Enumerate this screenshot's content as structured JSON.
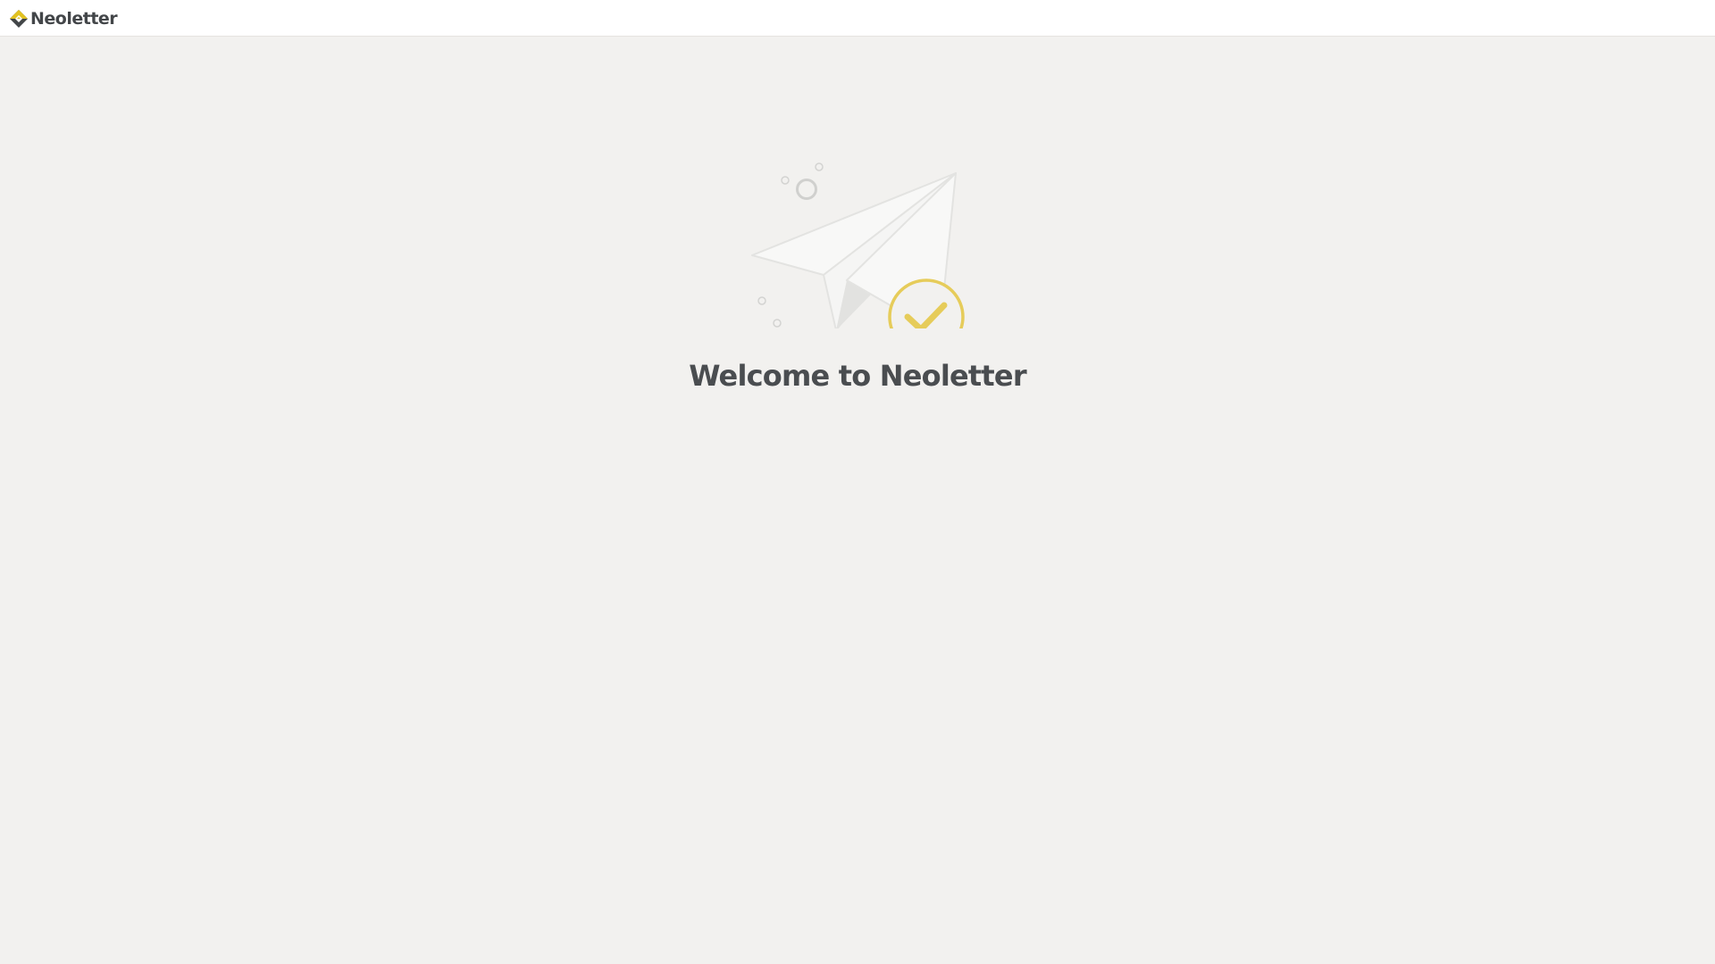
{
  "header": {
    "brand_name": "Neoletter",
    "logo_icon": "neoletter-logo-icon",
    "colors": {
      "brand_yellow": "#e2c21f",
      "brand_dark": "#434649"
    }
  },
  "main": {
    "illustration_icon": "paper-plane-check-icon",
    "welcome_title": "Welcome to Neoletter",
    "colors": {
      "check_accent": "#e6cc5a",
      "background": "#f2f1ef",
      "title": "#4a4d50"
    }
  }
}
